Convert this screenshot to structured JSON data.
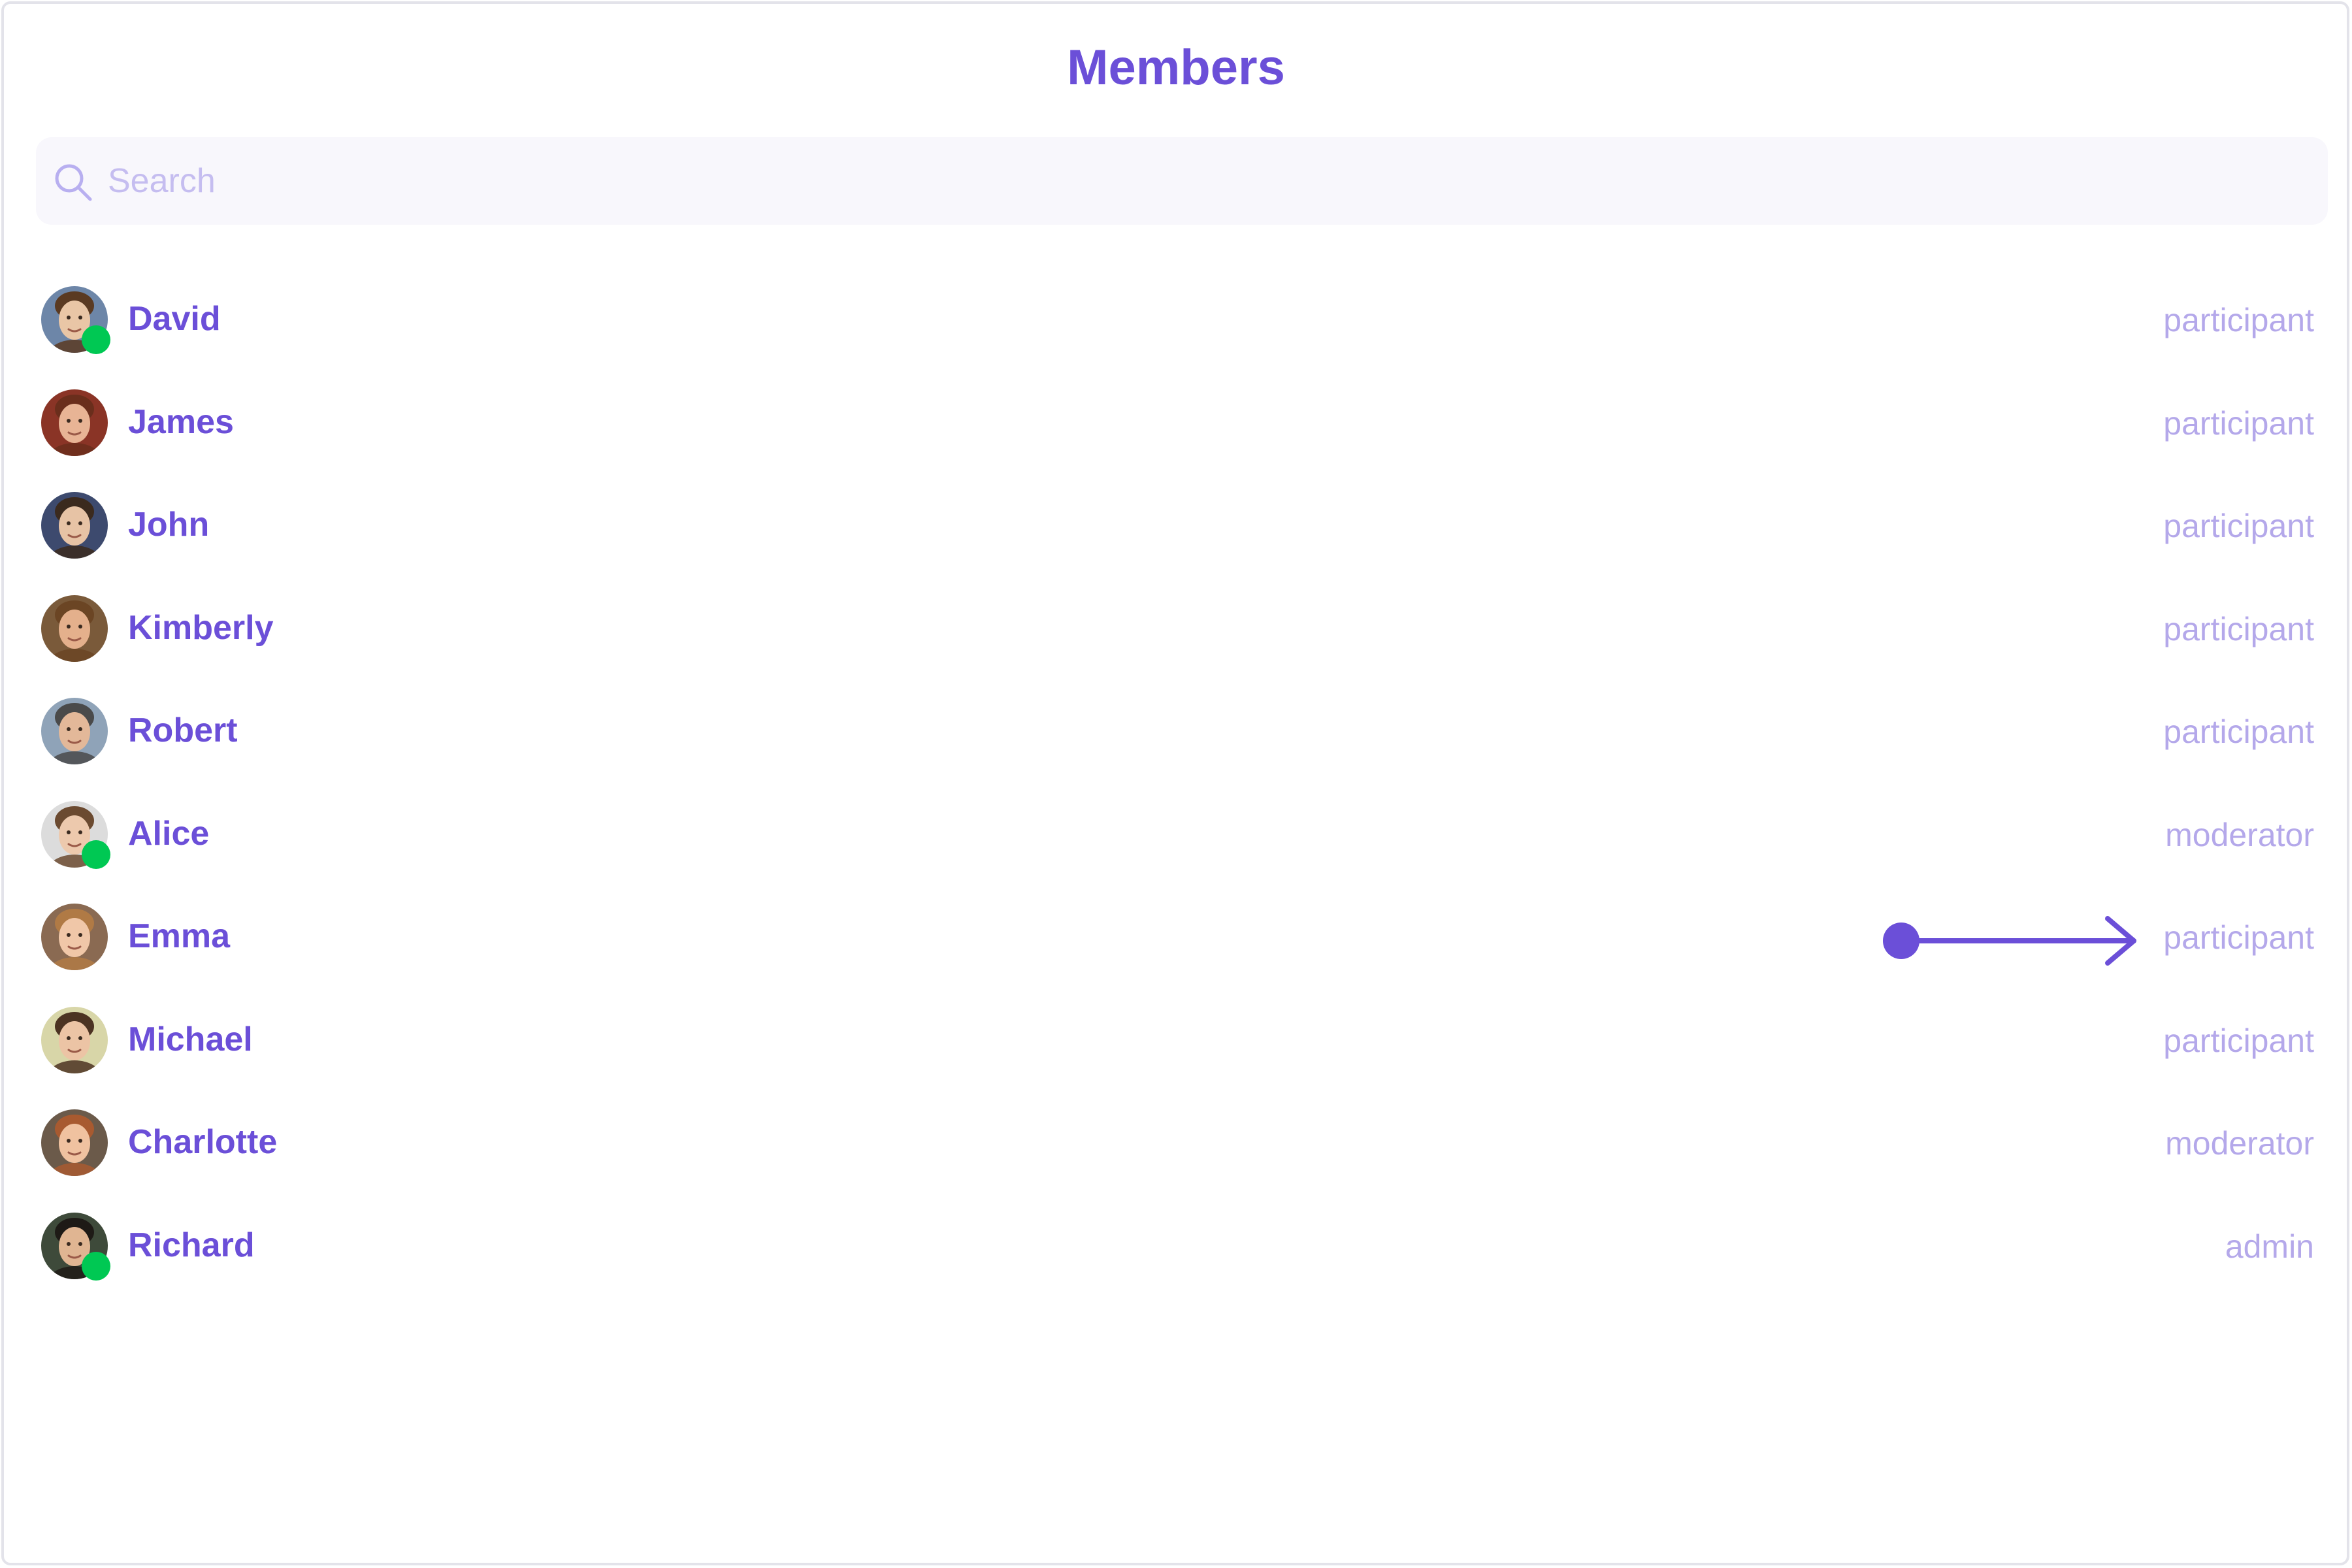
{
  "header": {
    "title": "Members"
  },
  "search": {
    "placeholder": "Search",
    "value": ""
  },
  "members": [
    {
      "name": "David",
      "role": "participant",
      "online": true,
      "avatar": {
        "bg": "#6d86a8",
        "skin": "#e9c6a6",
        "hair": "#5a3a22"
      }
    },
    {
      "name": "James",
      "role": "participant",
      "online": false,
      "avatar": {
        "bg": "#8a3426",
        "skin": "#e8b495",
        "hair": "#6a2e1c"
      }
    },
    {
      "name": "John",
      "role": "participant",
      "online": false,
      "avatar": {
        "bg": "#3d4a6e",
        "skin": "#e7c3a5",
        "hair": "#3b2a1e"
      }
    },
    {
      "name": "Kimberly",
      "role": "participant",
      "online": false,
      "avatar": {
        "bg": "#7a5a3a",
        "skin": "#e4b08c",
        "hair": "#6b4524"
      }
    },
    {
      "name": "Robert",
      "role": "participant",
      "online": false,
      "avatar": {
        "bg": "#8fa3b8",
        "skin": "#e3b899",
        "hair": "#4a4a4a"
      }
    },
    {
      "name": "Alice",
      "role": "moderator",
      "online": true,
      "avatar": {
        "bg": "#dcdcdc",
        "skin": "#edc9ad",
        "hair": "#6b4a30"
      }
    },
    {
      "name": "Emma",
      "role": "participant",
      "online": false,
      "avatar": {
        "bg": "#8a6a52",
        "skin": "#f0c7a8",
        "hair": "#b07a45"
      }
    },
    {
      "name": "Michael",
      "role": "participant",
      "online": false,
      "avatar": {
        "bg": "#d8d6a8",
        "skin": "#ecc4a5",
        "hair": "#4c3322"
      }
    },
    {
      "name": "Charlotte",
      "role": "moderator",
      "online": false,
      "avatar": {
        "bg": "#6b5a4a",
        "skin": "#f0c2a0",
        "hair": "#a85a30"
      }
    },
    {
      "name": "Richard",
      "role": "admin",
      "online": true,
      "avatar": {
        "bg": "#3e4a3a",
        "skin": "#e0b592",
        "hair": "#1e1a16"
      }
    }
  ],
  "colors": {
    "accent": "#6b4fd8",
    "role_text": "#b4a8ea",
    "online": "#00c853",
    "search_bg": "#f8f7fc"
  },
  "icons": {
    "search": "search-icon",
    "arrow": "arrow-right-icon"
  }
}
